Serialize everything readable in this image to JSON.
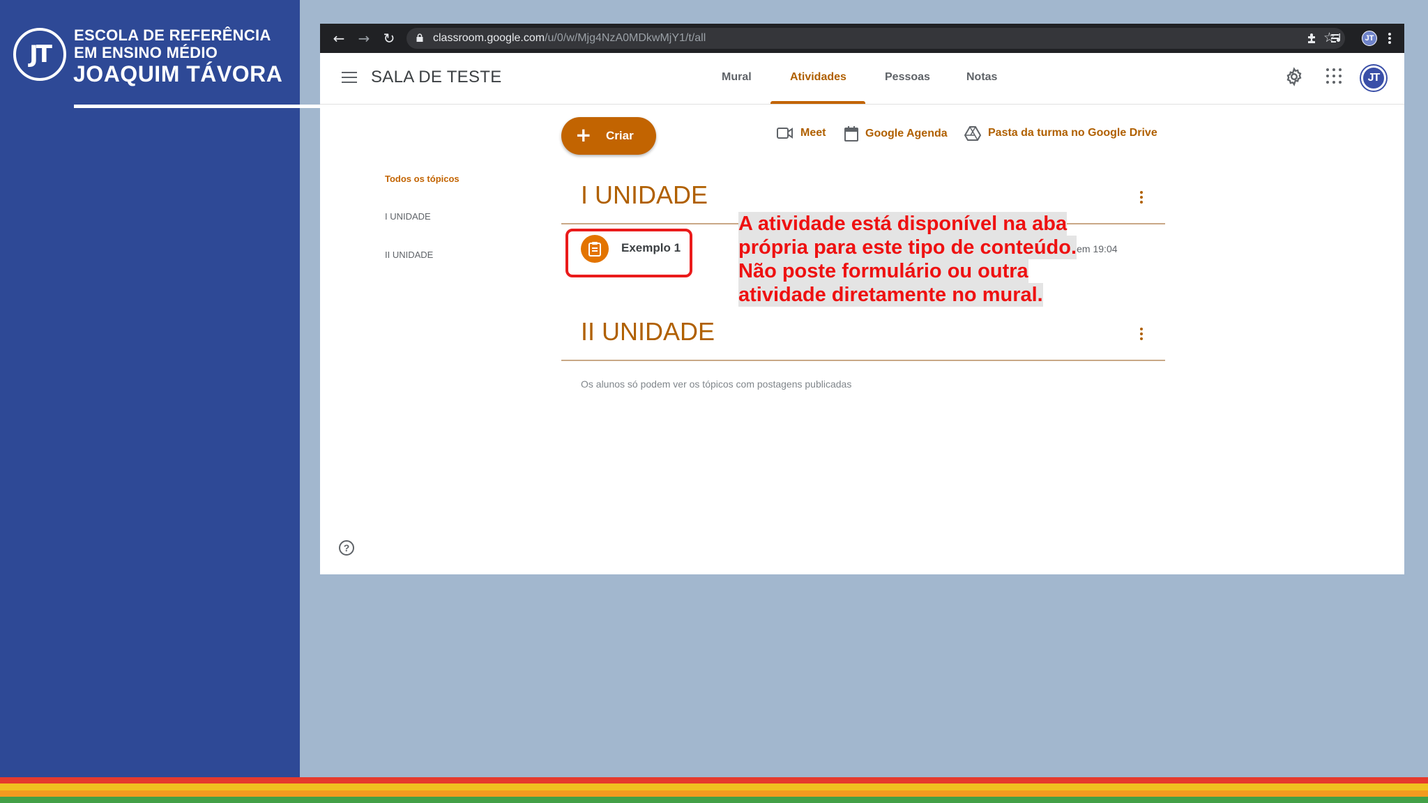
{
  "school": {
    "logo_text": "JT",
    "line1": "ESCOLA DE REFERÊNCIA",
    "line2": "EM ENSINO MÉDIO",
    "name": "JOAQUIM TÁVORA"
  },
  "browser": {
    "url_host": "classroom.google.com",
    "url_path": "/u/0/w/Mjg4NzA0MDkwMjY1/t/all",
    "profile_initials": "JT"
  },
  "classroom": {
    "class_name": "SALA DE TESTE",
    "tabs": [
      {
        "label": "Mural"
      },
      {
        "label": "Atividades",
        "active": true
      },
      {
        "label": "Pessoas"
      },
      {
        "label": "Notas"
      }
    ],
    "avatar_initials": "JT",
    "create_label": "Criar",
    "links": {
      "meet": "Meet",
      "calendar": "Google Agenda",
      "drive": "Pasta da turma no Google Drive"
    },
    "topic_nav": [
      "Todos os tópicos",
      "I UNIDADE",
      "II UNIDADE"
    ],
    "units": [
      {
        "title": "I UNIDADE"
      },
      {
        "title": "II UNIDADE"
      }
    ],
    "assignment": {
      "title": "Exemplo 1",
      "posted": "stado em 19:04"
    },
    "hint": "Os alunos só podem ver os tópicos com postagens publicadas",
    "help": "?"
  },
  "annotation": {
    "lines": [
      "A atividade está disponível na aba",
      "própria para este tipo de conteúdo.",
      "Não poste formulário ou outra",
      "atividade diretamente no mural."
    ]
  },
  "colors": {
    "accent": "#c26401",
    "annotation_red": "#ee1111",
    "side_panel": "#2e4996",
    "background": "#a2b7ce",
    "stripes": [
      "#e53a2d",
      "#f0c020",
      "#f39a1f",
      "#43a047"
    ]
  }
}
